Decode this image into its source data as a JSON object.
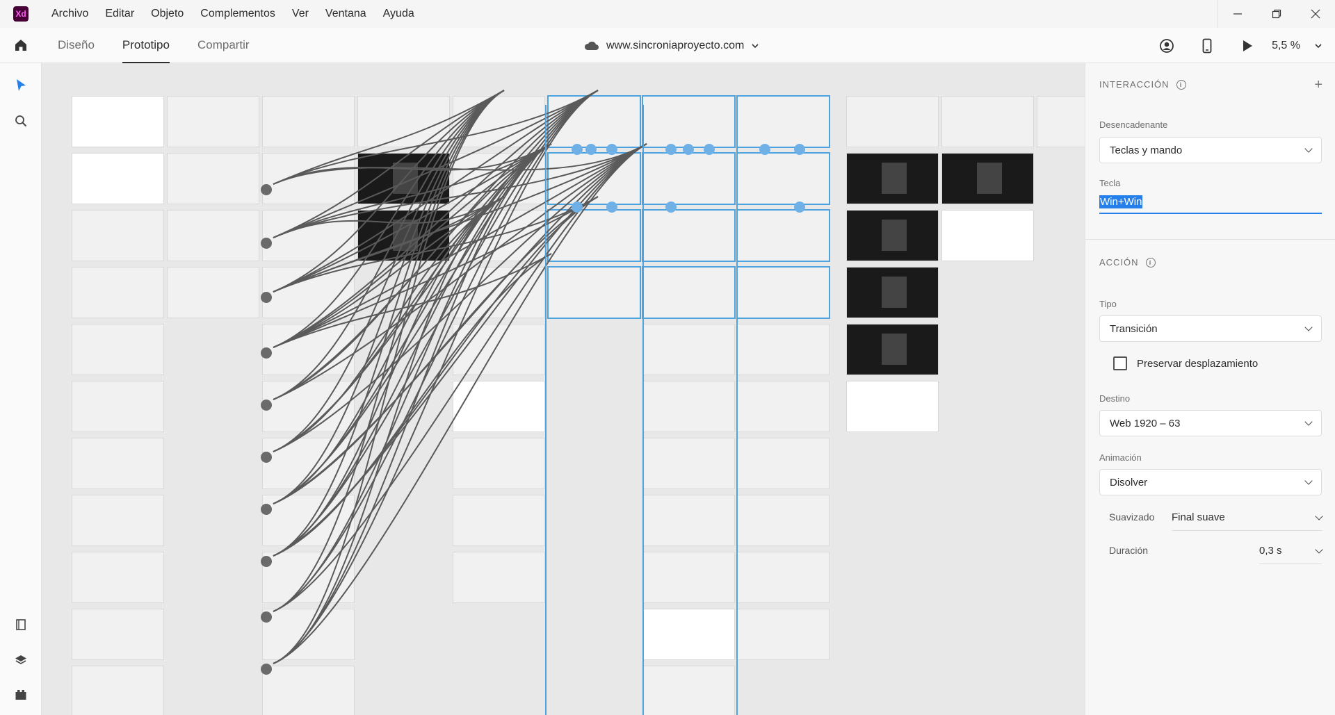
{
  "menu": [
    "Archivo",
    "Editar",
    "Objeto",
    "Complementos",
    "Ver",
    "Ventana",
    "Ayuda"
  ],
  "app_logo": "Xd",
  "tabs": [
    {
      "label": "Diseño",
      "active": false
    },
    {
      "label": "Prototipo",
      "active": true
    },
    {
      "label": "Compartir",
      "active": false
    }
  ],
  "document": {
    "title": "www.sincroniaproyecto.com"
  },
  "zoom": "5,5 %",
  "panel": {
    "interaction_header": "INTERACCIÓN",
    "trigger_label": "Desencadenante",
    "trigger_value": "Teclas y mando",
    "key_label": "Tecla",
    "key_value": "Win+Win",
    "action_header": "ACCIÓN",
    "type_label": "Tipo",
    "type_value": "Transición",
    "preserve_label": "Preservar desplazamiento",
    "preserve_checked": false,
    "destination_label": "Destino",
    "destination_value": "Web 1920 – 63",
    "animation_label": "Animación",
    "animation_value": "Disolver",
    "easing_label": "Suavizado",
    "easing_value": "Final suave",
    "duration_label": "Duración",
    "duration_value": "0,3 s"
  },
  "colors": {
    "accent": "#2680eb",
    "wire": "#5a5a5a",
    "selection": "#4ca3e0",
    "xd_brand": "#470137"
  }
}
